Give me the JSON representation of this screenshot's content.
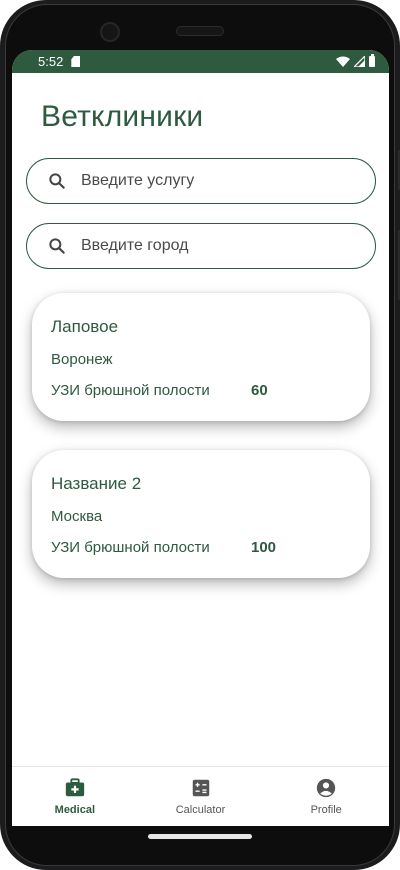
{
  "status_bar": {
    "time": "5:52"
  },
  "header": {
    "title": "Ветклиники"
  },
  "search": {
    "service_placeholder": "Введите услугу",
    "city_placeholder": "Введите город"
  },
  "clinics": [
    {
      "name": "Лаповое",
      "city": "Воронеж",
      "service": "УЗИ брюшной полости",
      "price": "60"
    },
    {
      "name": "Название 2",
      "city": "Москва",
      "service": "УЗИ брюшной полости",
      "price": "100"
    }
  ],
  "bottom_nav": {
    "items": [
      {
        "label": "Medical",
        "icon": "medical-kit-icon",
        "active": true
      },
      {
        "label": "Calculator",
        "icon": "calculator-icon",
        "active": false
      },
      {
        "label": "Profile",
        "icon": "account-circle-icon",
        "active": false
      }
    ]
  },
  "colors": {
    "primary": "#2e5a40",
    "status_bar": "#2e5a40",
    "inactive": "#555555"
  }
}
